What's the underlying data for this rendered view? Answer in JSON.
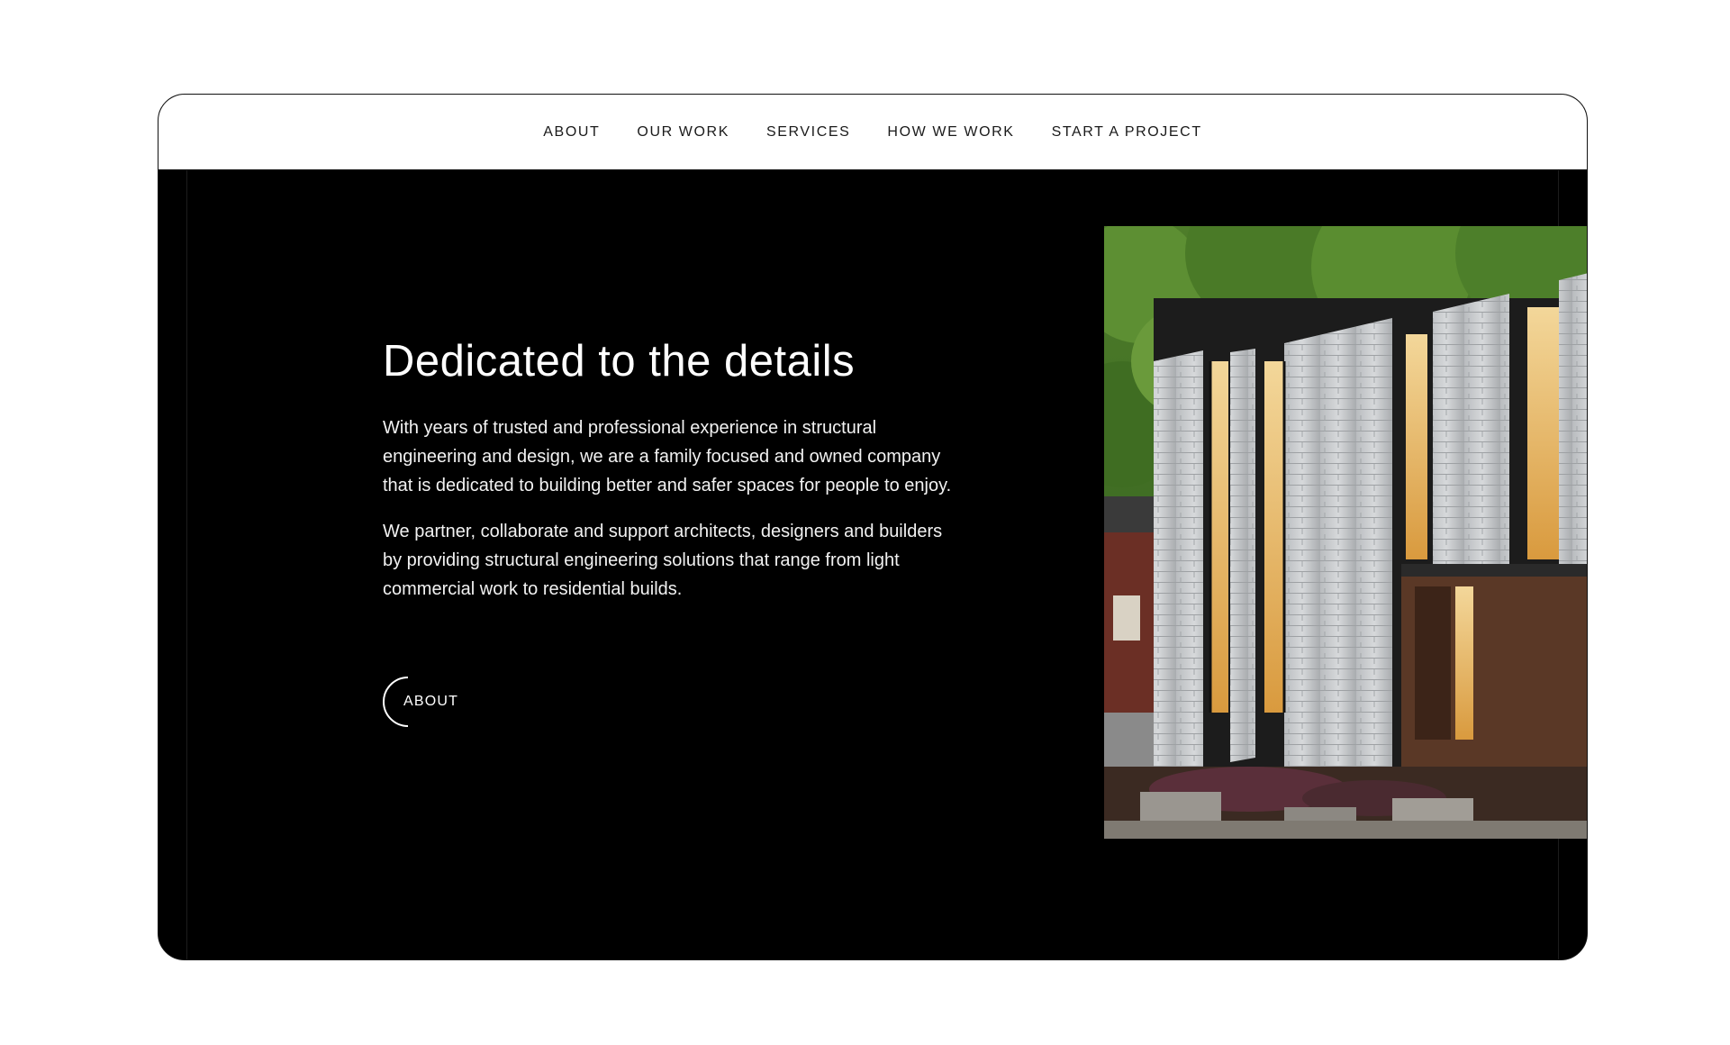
{
  "nav": {
    "items": [
      {
        "label": "ABOUT"
      },
      {
        "label": "OUR WORK"
      },
      {
        "label": "SERVICES"
      },
      {
        "label": "HOW WE WORK"
      },
      {
        "label": "START A PROJECT"
      }
    ]
  },
  "hero": {
    "title": "Dedicated to the details",
    "paragraphs": [
      "With years of trusted and professional experience in structural engineering and design, we are a family focused and owned company that is dedicated to building better and safer spaces for people to enjoy.",
      "We partner, collaborate and support architects, designers and builders by providing structural engineering solutions that range from light commercial work to residential builds."
    ],
    "button_label": "ABOUT"
  },
  "colors": {
    "background": "#000000",
    "nav_background": "#ffffff",
    "text": "#ffffff",
    "nav_text": "#1a1a1a"
  }
}
